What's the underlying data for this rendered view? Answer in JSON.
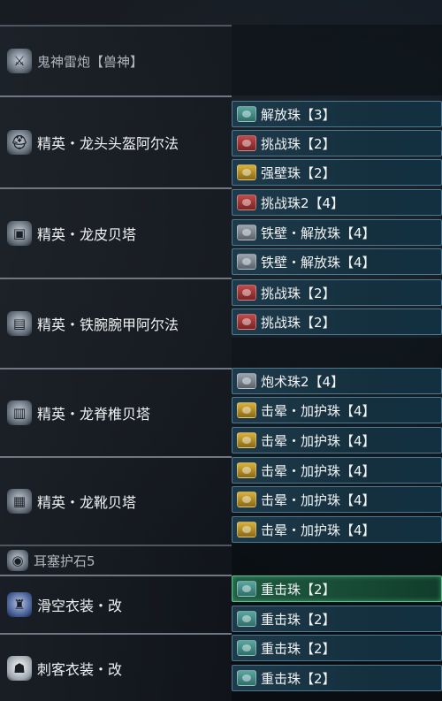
{
  "rows": [
    {
      "name": "鬼神雷炮【兽神】",
      "icon": "weapon-icon",
      "decos": []
    },
    {
      "name": "精英・龙头头盔阿尔法",
      "icon": "helmet-icon",
      "decos": [
        {
          "label": "解放珠【3】",
          "gem": "teal"
        },
        {
          "label": "挑战珠【2】",
          "gem": "red"
        },
        {
          "label": "强壁珠【2】",
          "gem": "gold"
        }
      ]
    },
    {
      "name": "精英・龙皮贝塔",
      "icon": "chest-armor-icon",
      "decos": [
        {
          "label": "挑战珠2【4】",
          "gem": "red"
        },
        {
          "label": "铁壁・解放珠【4】",
          "gem": "gray"
        },
        {
          "label": "铁壁・解放珠【4】",
          "gem": "gray"
        }
      ]
    },
    {
      "name": "精英・铁腕腕甲阿尔法",
      "icon": "arm-armor-icon",
      "decos": [
        {
          "label": "挑战珠【2】",
          "gem": "red"
        },
        {
          "label": "挑战珠【2】",
          "gem": "red"
        }
      ]
    },
    {
      "name": "精英・龙脊椎贝塔",
      "icon": "waist-armor-icon",
      "decos": [
        {
          "label": "炮术珠2【4】",
          "gem": "gray"
        },
        {
          "label": "击晕・加护珠【4】",
          "gem": "gold"
        },
        {
          "label": "击晕・加护珠【4】",
          "gem": "gold"
        }
      ]
    },
    {
      "name": "精英・龙靴贝塔",
      "icon": "leg-armor-icon",
      "decos": [
        {
          "label": "击晕・加护珠【4】",
          "gem": "gold"
        },
        {
          "label": "击晕・加护珠【4】",
          "gem": "gold"
        },
        {
          "label": "击晕・加护珠【4】",
          "gem": "gold"
        }
      ]
    },
    {
      "name": "耳塞护石5",
      "icon": "charm-icon",
      "decos": []
    },
    {
      "name": "滑空衣装・改",
      "icon": "glider-mantle-icon",
      "decos": [
        {
          "label": "重击珠【2】",
          "gem": "teal",
          "active": true
        },
        {
          "label": "重击珠【2】",
          "gem": "teal"
        }
      ]
    },
    {
      "name": "刺客衣装・改",
      "icon": "assassin-hood-icon",
      "decos": [
        {
          "label": "重击珠【2】",
          "gem": "teal"
        },
        {
          "label": "重击珠【2】",
          "gem": "teal"
        }
      ]
    }
  ],
  "colors": {
    "deco_bg": "#1f3a4a",
    "deco_border": "#4b7a90",
    "active_border": "#54c28a"
  }
}
